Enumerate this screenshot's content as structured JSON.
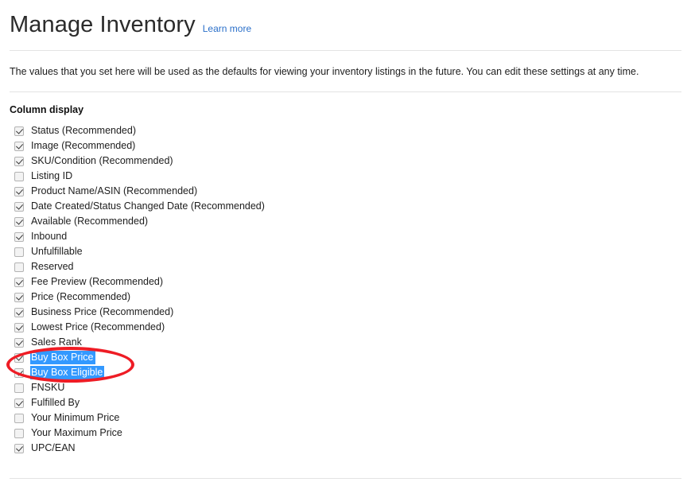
{
  "header": {
    "title": "Manage Inventory",
    "learn_more_label": "Learn more",
    "learn_more_color": "#2a6fc9"
  },
  "intro": {
    "text": "The values that you set here will be used as the defaults for viewing your inventory listings in the future. You can edit these settings at any time."
  },
  "section": {
    "title": "Column display"
  },
  "annotation": {
    "type": "red-ellipse-highlight",
    "color": "#ee1c25",
    "targets": [
      "Buy Box Price",
      "Buy Box Eligible"
    ]
  },
  "selection": {
    "highlight_color": "#3399ff",
    "text_color": "#ffffff"
  },
  "column_display": {
    "items": [
      {
        "label": "Status (Recommended)",
        "checked": true,
        "selected": false
      },
      {
        "label": "Image (Recommended)",
        "checked": true,
        "selected": false
      },
      {
        "label": "SKU/Condition (Recommended)",
        "checked": true,
        "selected": false
      },
      {
        "label": "Listing ID",
        "checked": false,
        "selected": false
      },
      {
        "label": "Product Name/ASIN (Recommended)",
        "checked": true,
        "selected": false
      },
      {
        "label": "Date Created/Status Changed Date (Recommended)",
        "checked": true,
        "selected": false
      },
      {
        "label": "Available (Recommended)",
        "checked": true,
        "selected": false
      },
      {
        "label": "Inbound",
        "checked": true,
        "selected": false
      },
      {
        "label": "Unfulfillable",
        "checked": false,
        "selected": false
      },
      {
        "label": "Reserved",
        "checked": false,
        "selected": false
      },
      {
        "label": "Fee Preview (Recommended)",
        "checked": true,
        "selected": false
      },
      {
        "label": "Price (Recommended)",
        "checked": true,
        "selected": false
      },
      {
        "label": "Business Price (Recommended)",
        "checked": true,
        "selected": false
      },
      {
        "label": "Lowest Price (Recommended)",
        "checked": true,
        "selected": false
      },
      {
        "label": "Sales Rank",
        "checked": true,
        "selected": false
      },
      {
        "label": "Buy Box Price",
        "checked": true,
        "selected": true
      },
      {
        "label": "Buy Box Eligible",
        "checked": true,
        "selected": true
      },
      {
        "label": "FNSKU",
        "checked": false,
        "selected": false
      },
      {
        "label": "Fulfilled By",
        "checked": true,
        "selected": false
      },
      {
        "label": "Your Minimum Price",
        "checked": false,
        "selected": false
      },
      {
        "label": "Your Maximum Price",
        "checked": false,
        "selected": false
      },
      {
        "label": "UPC/EAN",
        "checked": true,
        "selected": false
      }
    ]
  }
}
